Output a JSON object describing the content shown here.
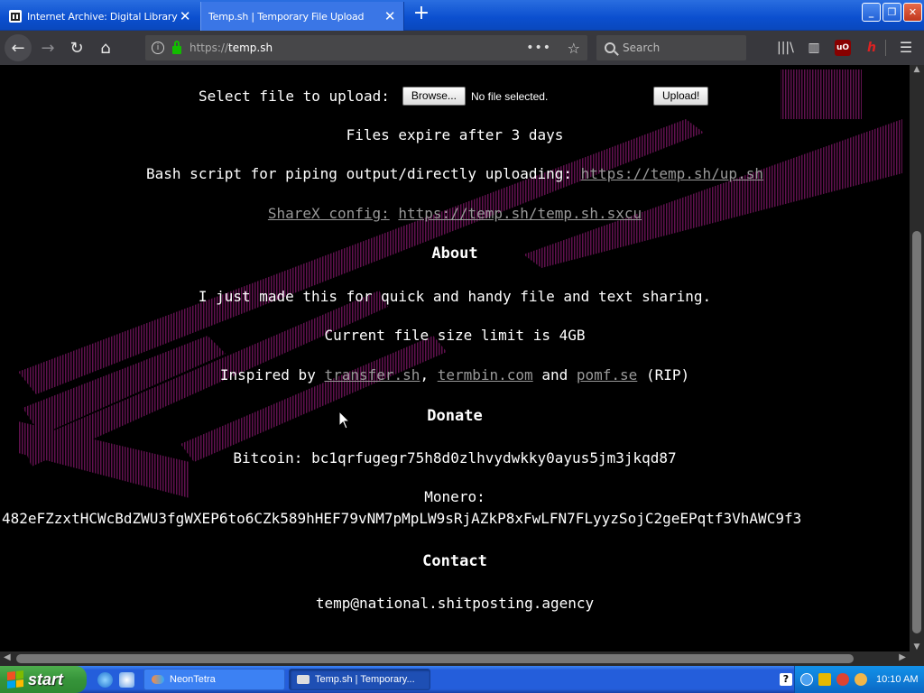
{
  "browser": {
    "tabs": [
      {
        "title": "Internet Archive: Digital Library of",
        "active": false
      },
      {
        "title": "Temp.sh | Temporary File Upload",
        "active": true
      }
    ],
    "new_tab_label": "+",
    "url": {
      "protocol": "https://",
      "host": "temp.sh"
    },
    "search_placeholder": "Search"
  },
  "page": {
    "upload_label": "Select file to upload:",
    "browse_button": "Browse...",
    "no_file_text": "No file selected.",
    "upload_button": "Upload!",
    "expire_text": "Files expire after 3 days",
    "bash_label": "Bash script for piping output/directly uploading:",
    "bash_link": "https://temp.sh/up.sh",
    "sharex_label": "ShareX config:",
    "sharex_link": "https://temp.sh/temp.sh.sxcu",
    "about_heading": "About",
    "about_text": "I just made this for quick and handy file and text sharing.",
    "size_limit_text": "Current file size limit is 4GB",
    "inspired_prefix": "Inspired by",
    "inspired_links": [
      "transfer.sh",
      "termbin.com",
      "pomf.se"
    ],
    "inspired_sep": ",",
    "inspired_and": "and",
    "inspired_suffix": "(RIP)",
    "donate_heading": "Donate",
    "bitcoin_label": "Bitcoin:",
    "bitcoin_address": "bc1qrfugegr75h8d0zlhvydwkky0ayus5jm3jkqd87",
    "monero_label": "Monero:",
    "monero_address": "482eFZzxtHCWcBdZWU3fgWXEP6to6CZk589hHEF79vNM7pMpLW9sRjAZkP8xFwLFN7FLyyzSojC2geEPqtf3VhAWC9f3",
    "contact_heading": "Contact",
    "contact_email": "temp@national.shitposting.agency"
  },
  "taskbar": {
    "start_label": "start",
    "tasks": [
      {
        "title": "NeonTetra"
      },
      {
        "title": "Temp.sh | Temporary..."
      }
    ],
    "clock": "10:10 AM"
  },
  "icons": {
    "back": "back-arrow-icon",
    "forward": "forward-arrow-icon",
    "reload": "reload-icon",
    "home": "home-icon",
    "library": "library-icon",
    "sidebar": "sidebar-icon",
    "ublock": "ublock-icon",
    "menu": "hamburger-menu-icon"
  },
  "colors": {
    "page_background": "#000000",
    "link": "#999999",
    "art_magenta": "#b0208f",
    "taskbar_blue": "#245edb",
    "start_green": "#36943a"
  }
}
